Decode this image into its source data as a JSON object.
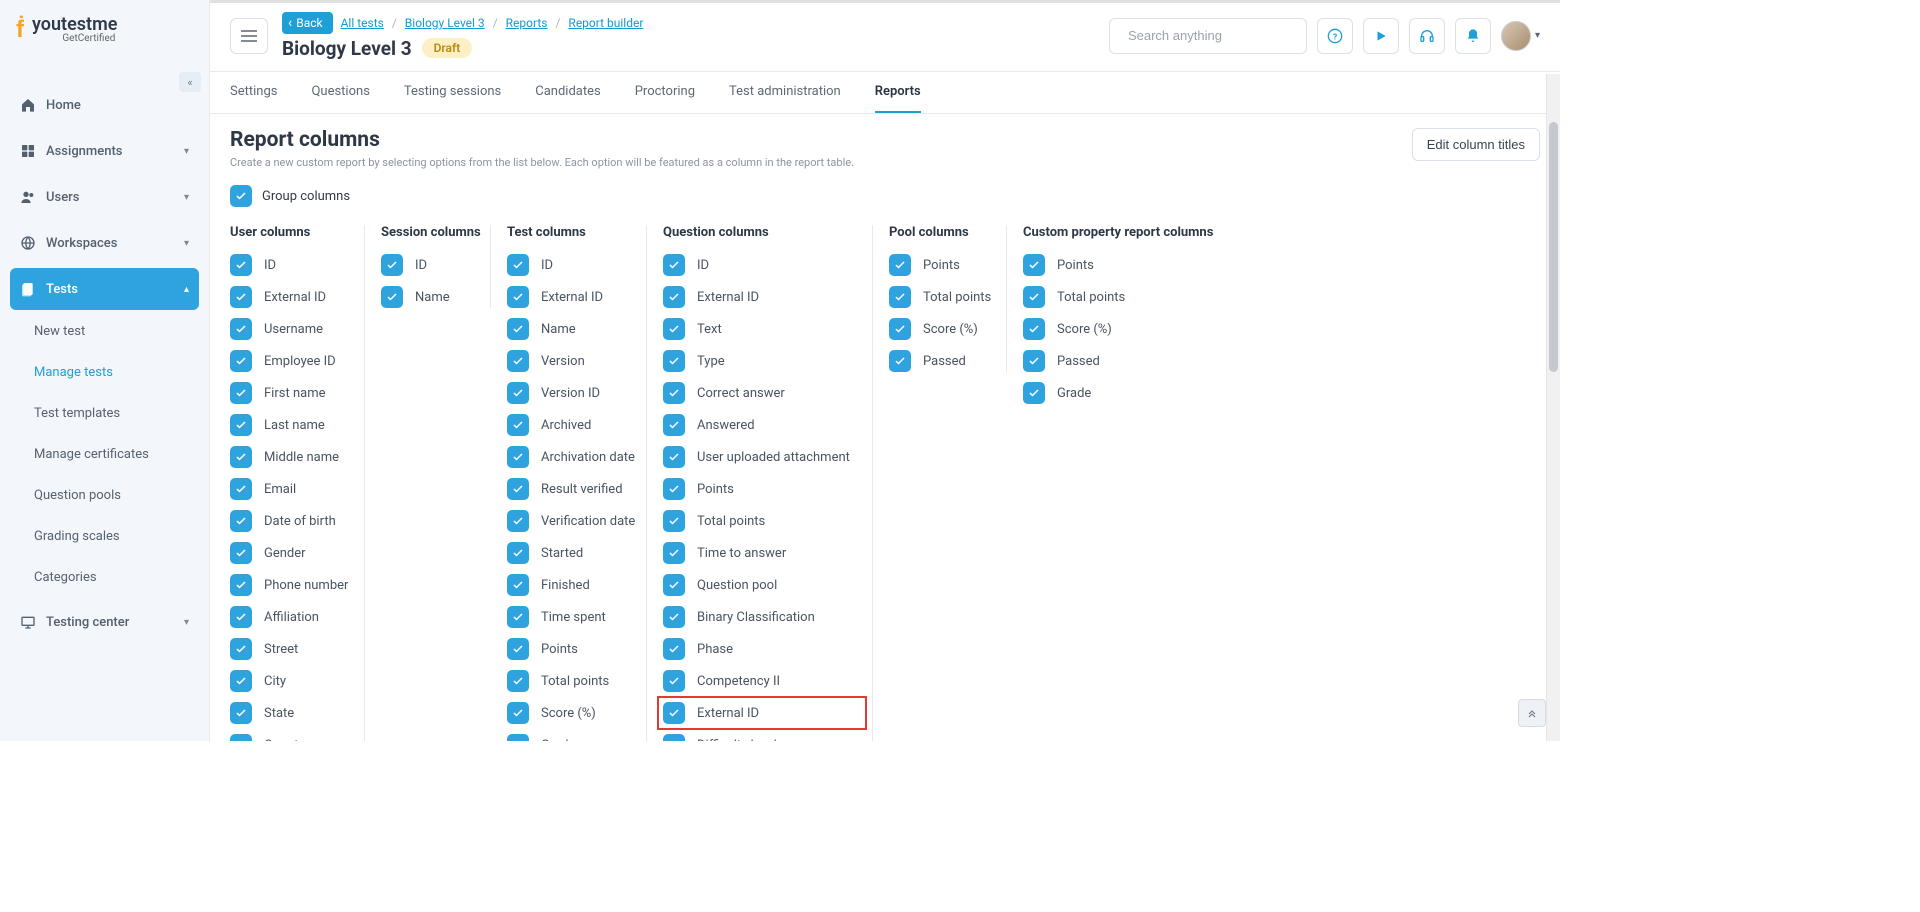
{
  "app": {
    "brand": "youtestme",
    "subbrand": "GetCertified"
  },
  "sidebar": {
    "items": [
      {
        "icon": "home-icon",
        "label": "Home",
        "has_caret": false
      },
      {
        "icon": "assignments-icon",
        "label": "Assignments",
        "has_caret": true
      },
      {
        "icon": "users-icon",
        "label": "Users",
        "has_caret": true
      },
      {
        "icon": "workspaces-icon",
        "label": "Workspaces",
        "has_caret": true
      },
      {
        "icon": "tests-icon",
        "label": "Tests",
        "has_caret": true,
        "active": true
      },
      {
        "icon": "testing-center-icon",
        "label": "Testing center",
        "has_caret": true
      }
    ],
    "tests_sub": [
      {
        "label": "New test"
      },
      {
        "label": "Manage tests",
        "active": true
      },
      {
        "label": "Test templates"
      },
      {
        "label": "Manage certificates"
      },
      {
        "label": "Question pools"
      },
      {
        "label": "Grading scales"
      },
      {
        "label": "Categories"
      }
    ]
  },
  "header": {
    "back": "Back",
    "crumbs": [
      "All tests",
      "Biology Level 3",
      "Reports",
      "Report builder"
    ],
    "title": "Biology Level 3",
    "badge": "Draft",
    "search_placeholder": "Search anything"
  },
  "tabs": [
    "Settings",
    "Questions",
    "Testing sessions",
    "Candidates",
    "Proctoring",
    "Test administration",
    "Reports"
  ],
  "active_tab": "Reports",
  "section": {
    "title": "Report columns",
    "desc": "Create a new custom report by selecting options from the list below. Each option will be featured as a column in the report table.",
    "edit_btn": "Edit column titles",
    "group_label": "Group columns"
  },
  "columns": {
    "user": {
      "title": "User columns",
      "items": [
        "ID",
        "External ID",
        "Username",
        "Employee ID",
        "First name",
        "Last name",
        "Middle name",
        "Email",
        "Date of birth",
        "Gender",
        "Phone number",
        "Affiliation",
        "Street",
        "City",
        "State",
        "Country"
      ]
    },
    "session": {
      "title": "Session columns",
      "items": [
        "ID",
        "Name"
      ]
    },
    "test": {
      "title": "Test columns",
      "items": [
        "ID",
        "External ID",
        "Name",
        "Version",
        "Version ID",
        "Archived",
        "Archivation date",
        "Result verified",
        "Verification date",
        "Started",
        "Finished",
        "Time spent",
        "Points",
        "Total points",
        "Score (%)",
        "Grade"
      ]
    },
    "question": {
      "title": "Question columns",
      "items": [
        "ID",
        "External ID",
        "Text",
        "Type",
        "Correct answer",
        "Answered",
        "User uploaded attachment",
        "Points",
        "Total points",
        "Time to answer",
        "Question pool",
        "Binary Classification",
        "Phase",
        "Competency II",
        "External ID",
        "Difficulty level"
      ],
      "highlight_index": 14
    },
    "pool": {
      "title": "Pool columns",
      "items": [
        "Points",
        "Total points",
        "Score (%)",
        "Passed"
      ]
    },
    "custom": {
      "title": "Custom property report columns",
      "items": [
        "Points",
        "Total points",
        "Score (%)",
        "Passed",
        "Grade"
      ]
    }
  }
}
